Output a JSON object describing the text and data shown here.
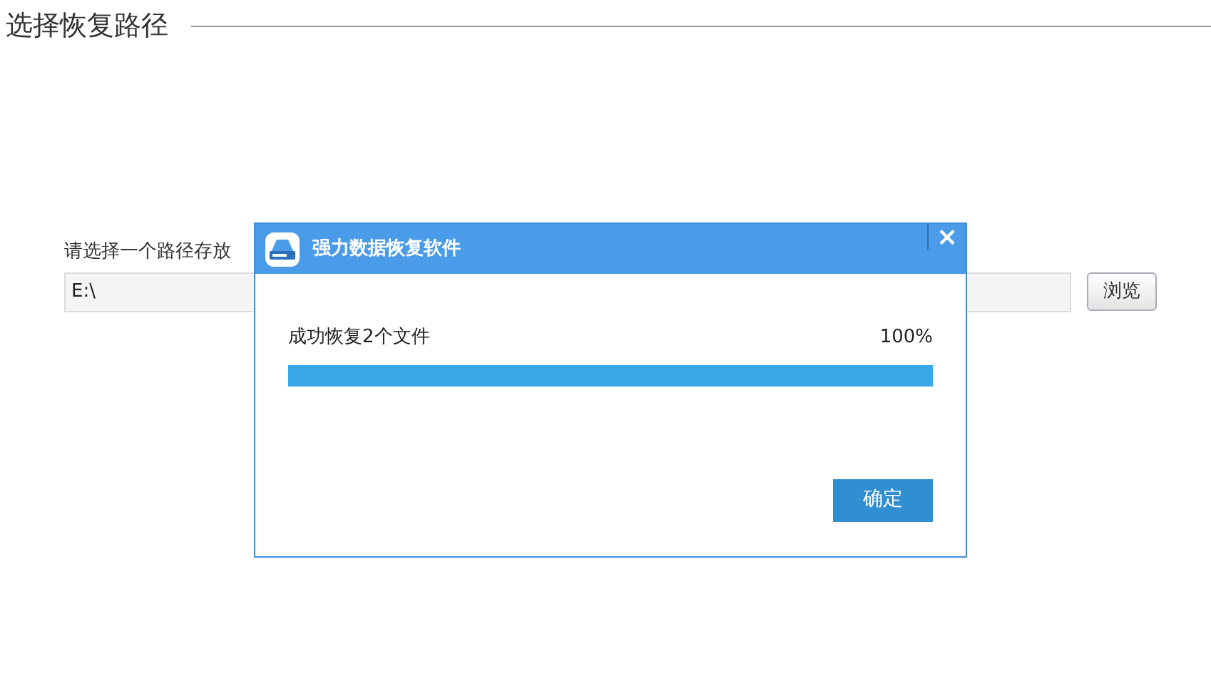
{
  "section_title": "选择恢复路径",
  "path_label": "请选择一个路径存放",
  "path_field": {
    "value": "E:\\"
  },
  "browse_button": "浏览",
  "dialog": {
    "title": "强力数据恢复软件",
    "close": "×",
    "message": "成功恢复2个文件",
    "percent": "100%",
    "progress": {
      "level": 1
    },
    "ok_button": "确定"
  }
}
